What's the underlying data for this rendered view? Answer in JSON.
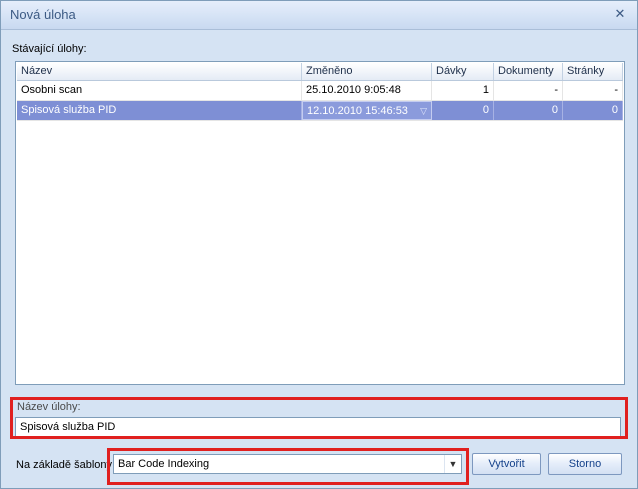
{
  "window": {
    "title": "Nová úloha"
  },
  "existing_tasks": {
    "label": "Stávající úlohy:",
    "columns": [
      "Název",
      "Změněno",
      "Dávky",
      "Dokumenty",
      "Stránky"
    ],
    "rows": [
      {
        "name": "Osobni scan",
        "modified": "25.10.2010 9:05:48",
        "batches": "1",
        "documents": "-",
        "pages": "-"
      },
      {
        "name": "Spisová služba PID",
        "modified": "12.10.2010 15:46:53",
        "batches": "0",
        "documents": "0",
        "pages": "0",
        "selected": true
      }
    ]
  },
  "task_name": {
    "label": "Název úlohy:",
    "value": "Spisová služba PID"
  },
  "template": {
    "label": "Na základě šablony",
    "selected": "Bar Code Indexing"
  },
  "buttons": {
    "create": "Vytvořit",
    "cancel": "Storno"
  },
  "colors": {
    "highlight": "#e0201f",
    "selection": "#7e8fd5",
    "title_text": "#3c5a84"
  }
}
